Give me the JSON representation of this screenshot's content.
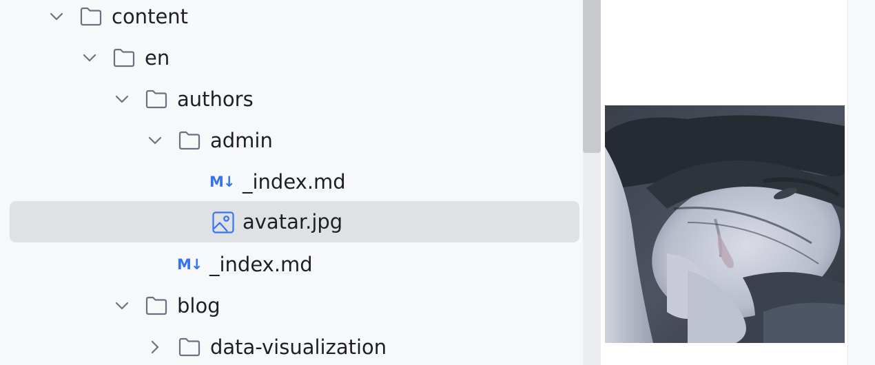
{
  "project_tree": {
    "items": [
      {
        "label": "content",
        "type": "folder",
        "expanded": true
      },
      {
        "label": "en",
        "type": "folder",
        "expanded": true
      },
      {
        "label": "authors",
        "type": "folder",
        "expanded": true
      },
      {
        "label": "admin",
        "type": "folder",
        "expanded": true
      },
      {
        "label": "_index.md",
        "type": "markdown",
        "icon_text": "M↓"
      },
      {
        "label": "avatar.jpg",
        "type": "image",
        "selected": true
      },
      {
        "label": "_index.md",
        "type": "markdown",
        "icon_text": "M↓"
      },
      {
        "label": "blog",
        "type": "folder",
        "expanded": true
      },
      {
        "label": "data-visualization",
        "type": "folder",
        "expanded": false
      }
    ]
  },
  "icons": {
    "expanded": "chevron-down-icon",
    "collapsed": "chevron-right-icon",
    "folder": "folder-icon",
    "markdown": "markdown-icon",
    "image": "image-file-icon"
  },
  "colors": {
    "tree_background": "#f7f8fa",
    "selection": "#dfe1e5",
    "accent": "#3574f0",
    "text": "#1e1f22"
  }
}
